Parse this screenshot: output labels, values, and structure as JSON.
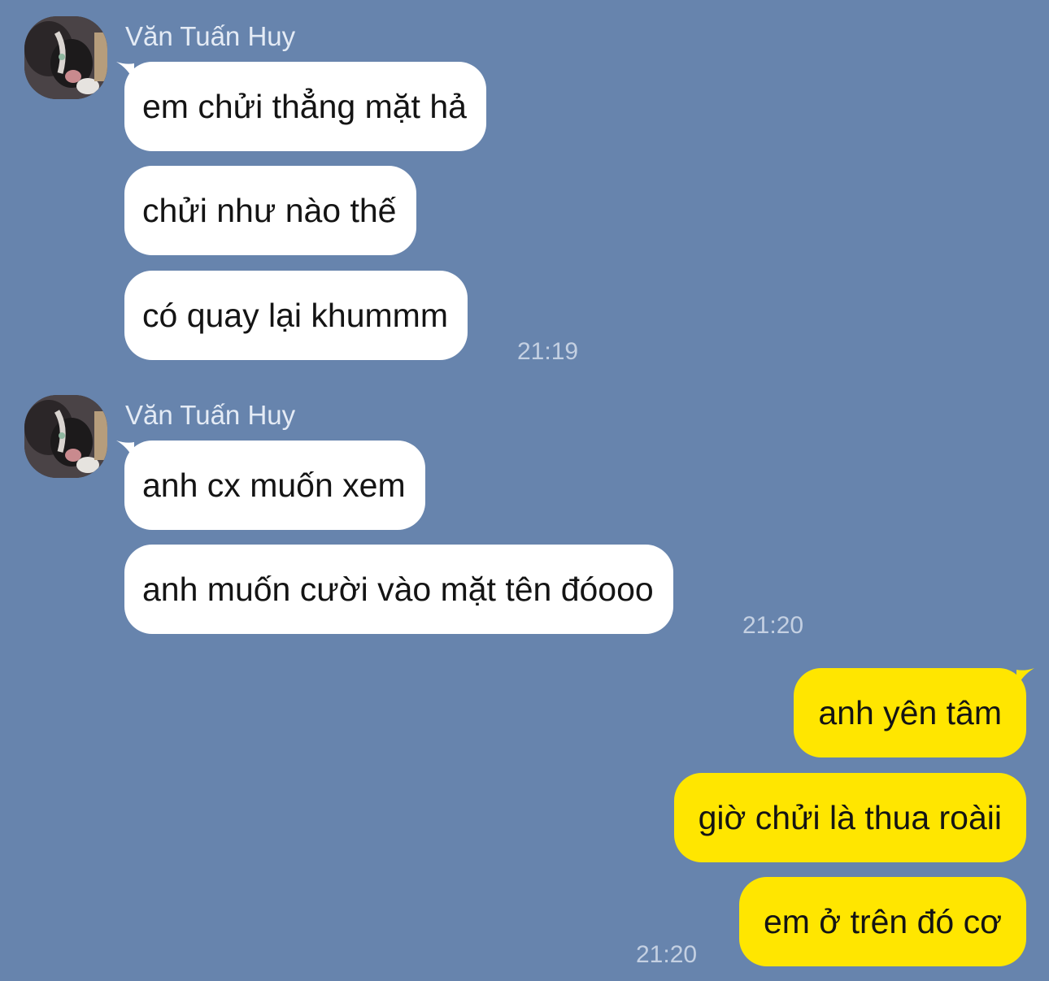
{
  "chat": {
    "background_color": "#6784ad",
    "incoming_bubble_color": "#ffffff",
    "outgoing_bubble_color": "#ffe600",
    "groups": [
      {
        "sender": "Văn Tuấn Huy",
        "avatar_icon": "cat-avatar-icon",
        "messages": [
          "em chửi thẳng mặt hả",
          "chửi như nào thế",
          "có quay lại khummm"
        ],
        "time": "21:19"
      },
      {
        "sender": "Văn Tuấn Huy",
        "avatar_icon": "cat-avatar-icon",
        "messages": [
          "anh cx muốn xem",
          "anh muốn cười vào mặt tên đóooo"
        ],
        "time": "21:20"
      }
    ],
    "outgoing": {
      "messages": [
        "anh yên tâm",
        "giờ chửi là thua roàii",
        "em ở trên đó cơ"
      ],
      "time": "21:20"
    }
  }
}
